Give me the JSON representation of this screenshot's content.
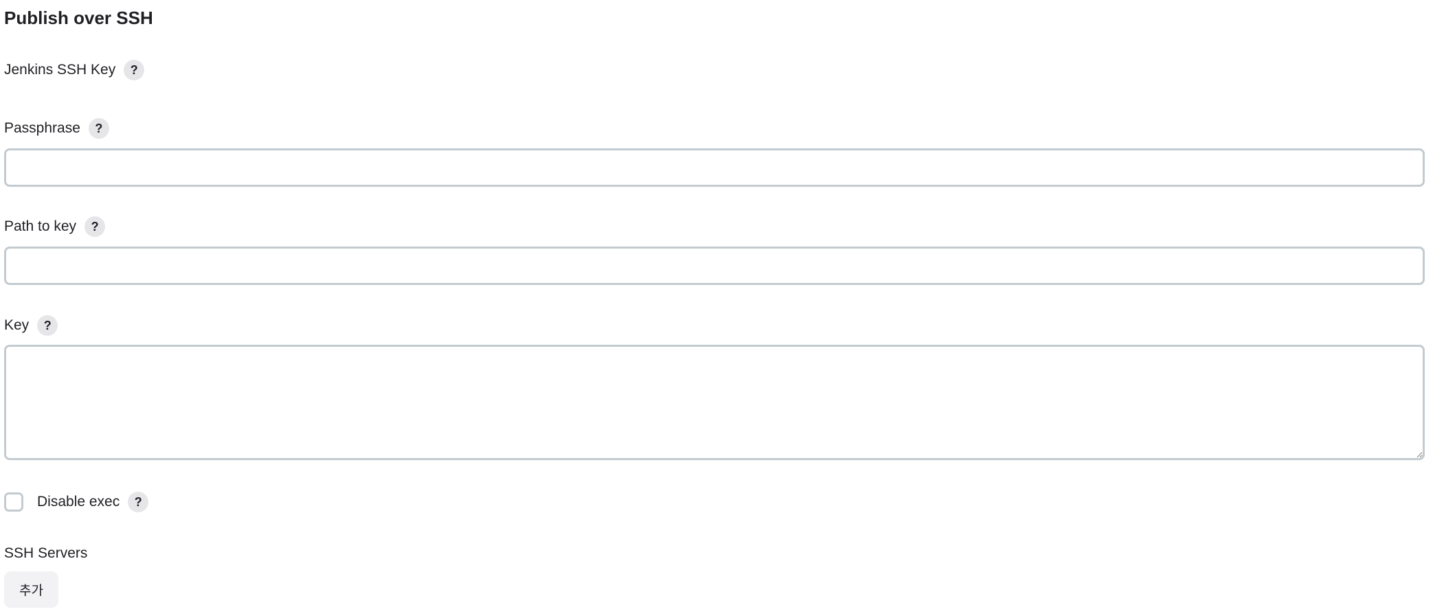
{
  "section": {
    "title": "Publish over SSH"
  },
  "fields": {
    "jenkins_ssh_key": {
      "label": "Jenkins SSH Key",
      "help": "?"
    },
    "passphrase": {
      "label": "Passphrase",
      "help": "?",
      "value": ""
    },
    "path_to_key": {
      "label": "Path to key",
      "help": "?",
      "value": ""
    },
    "key": {
      "label": "Key",
      "help": "?",
      "value": ""
    },
    "disable_exec": {
      "label": "Disable exec",
      "help": "?",
      "checked": false
    },
    "ssh_servers": {
      "label": "SSH Servers",
      "add_button": "추가"
    }
  }
}
